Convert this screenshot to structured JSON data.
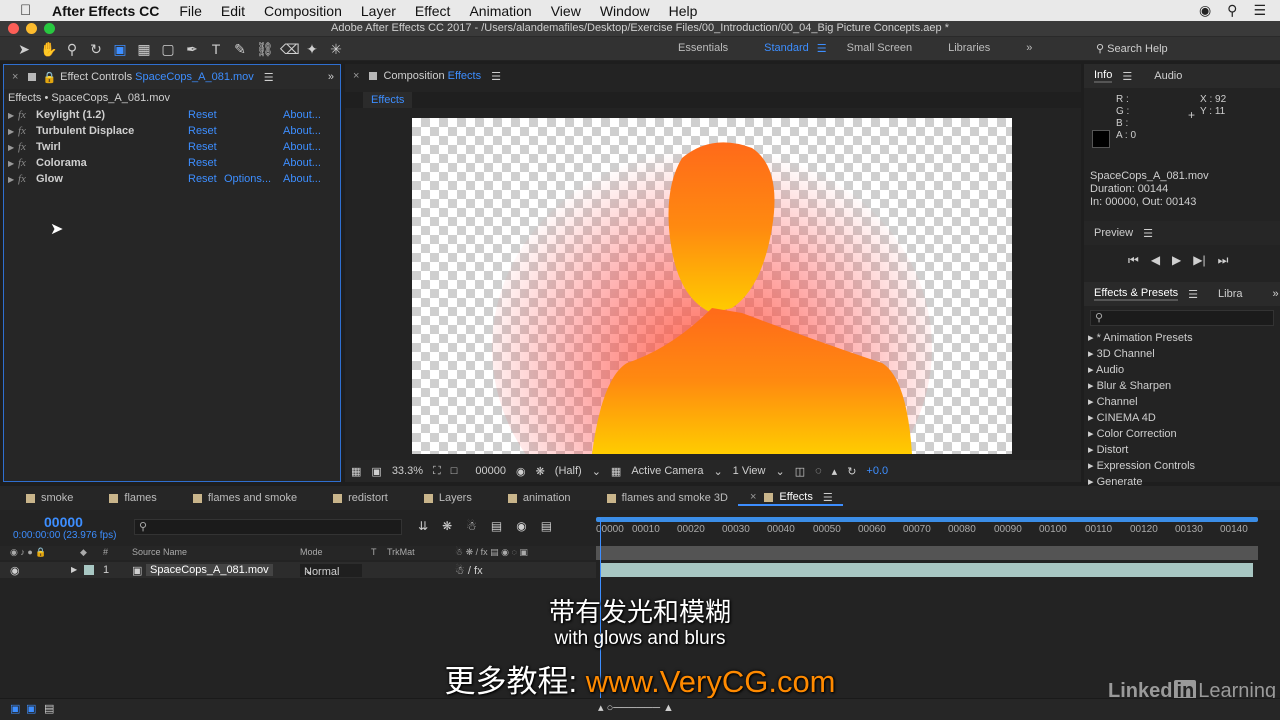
{
  "menubar": {
    "app": "After Effects CC",
    "items": [
      "File",
      "Edit",
      "Composition",
      "Layer",
      "Effect",
      "Animation",
      "View",
      "Window",
      "Help"
    ]
  },
  "window": {
    "title": "Adobe After Effects CC 2017 - /Users/alandemafiles/Desktop/Exercise Files/00_Introduction/00_04_Big Picture Concepts.aep *"
  },
  "workspaces": {
    "items": [
      "Essentials",
      "Standard",
      "Small Screen",
      "Libraries"
    ],
    "current": "Standard",
    "search": "Search Help"
  },
  "effect_controls": {
    "tab_prefix": "Effect Controls",
    "tab_file": "SpaceCops_A_081.mov",
    "subheader": "Effects • SpaceCops_A_081.mov",
    "effects": [
      {
        "name": "Keylight (1.2)",
        "reset": "Reset",
        "options": "",
        "about": "About..."
      },
      {
        "name": "Turbulent Displace",
        "reset": "Reset",
        "options": "",
        "about": "About..."
      },
      {
        "name": "Twirl",
        "reset": "Reset",
        "options": "",
        "about": "About..."
      },
      {
        "name": "Colorama",
        "reset": "Reset",
        "options": "",
        "about": "About..."
      },
      {
        "name": "Glow",
        "reset": "Reset",
        "options": "Options...",
        "about": "About..."
      }
    ]
  },
  "composition": {
    "tab_prefix": "Composition",
    "tab_name": "Effects",
    "subtab": "Effects",
    "zoom": "33.3%",
    "timecode": "00000",
    "resolution": "(Half)",
    "camera": "Active Camera",
    "views": "1 View",
    "exposure": "+0.0"
  },
  "info": {
    "tabs": [
      "Info",
      "Audio"
    ],
    "r": "R :",
    "g": "G :",
    "b": "B :",
    "a": "A : 0",
    "x": "X : 92",
    "y": "Y : 11",
    "clip_name": "SpaceCops_A_081.mov",
    "duration": "Duration: 00144",
    "inout": "In: 00000, Out: 00143"
  },
  "preview": {
    "title": "Preview"
  },
  "effects_presets": {
    "tabs": [
      "Effects & Presets",
      "Libra"
    ],
    "items": [
      "* Animation Presets",
      "3D Channel",
      "Audio",
      "Blur & Sharpen",
      "Channel",
      "CINEMA 4D",
      "Color Correction",
      "Distort",
      "Expression Controls",
      "Generate"
    ]
  },
  "timeline": {
    "tabs": [
      "smoke",
      "flames",
      "flames and smoke",
      "redistort",
      "Layers",
      "animation",
      "flames and smoke 3D",
      "Effects"
    ],
    "current_tab": "Effects",
    "timecode": "00000",
    "timecode_sub": "0:00:00:00 (23.976 fps)",
    "ruler": [
      "00000",
      "00010",
      "00020",
      "00030",
      "00040",
      "00050",
      "00060",
      "00070",
      "00080",
      "00090",
      "00100",
      "00110",
      "00120",
      "00130",
      "00140"
    ],
    "columns": {
      "num": "#",
      "source": "Source Name",
      "mode": "Mode",
      "t": "T",
      "trkmat": "TrkMat"
    },
    "layer": {
      "index": "1",
      "name": "SpaceCops_A_081.mov",
      "mode": "Normal"
    }
  },
  "overlay": {
    "subtitle_cn": "带有发光和模糊",
    "subtitle_en": "with glows and blurs",
    "watermark_label": "更多教程:",
    "watermark_url": "www.VeryCG.com",
    "brand_pre": "Linked",
    "brand_in": "in",
    "brand_post": "Learning"
  },
  "colors": {
    "accent": "#3d8eff",
    "glow_core": "#ffcc00",
    "glow_outer": "#ff3b3b"
  }
}
